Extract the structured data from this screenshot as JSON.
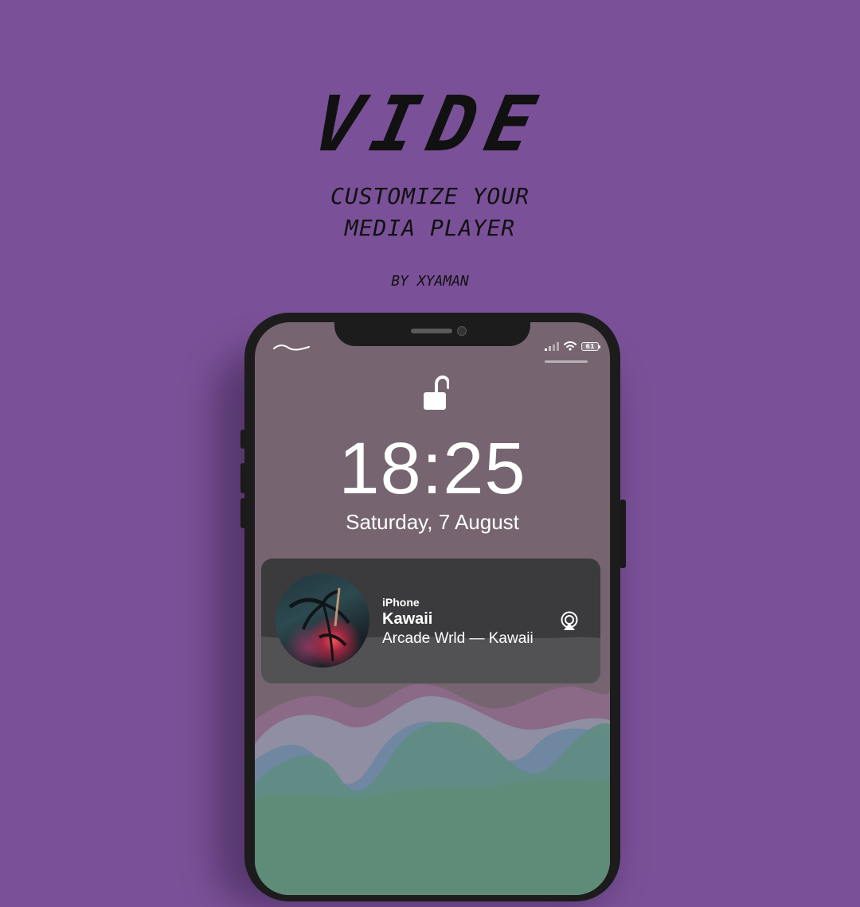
{
  "promo": {
    "title": "VIDE",
    "subtitle_line1": "CUSTOMIZE YOUR",
    "subtitle_line2": "MEDIA PLAYER",
    "author": "BY XYAMAN"
  },
  "status_bar": {
    "battery_level": "61",
    "icons": [
      "signal-icon",
      "wifi-icon",
      "battery-icon"
    ]
  },
  "lockscreen": {
    "lock_icon": "unlock-icon",
    "time": "18:25",
    "date": "Saturday, 7 August"
  },
  "media_player": {
    "device": "iPhone",
    "song_title": "Kawaii",
    "artist_line": "Arcade Wrld — Kawaii",
    "output_icon": "airplay-icon",
    "artwork_icon": "album-artwork"
  },
  "colors": {
    "background": "#7a5198",
    "screen": "#766570",
    "player_top": "#3b3b3e",
    "player_bottom": "#525255"
  }
}
